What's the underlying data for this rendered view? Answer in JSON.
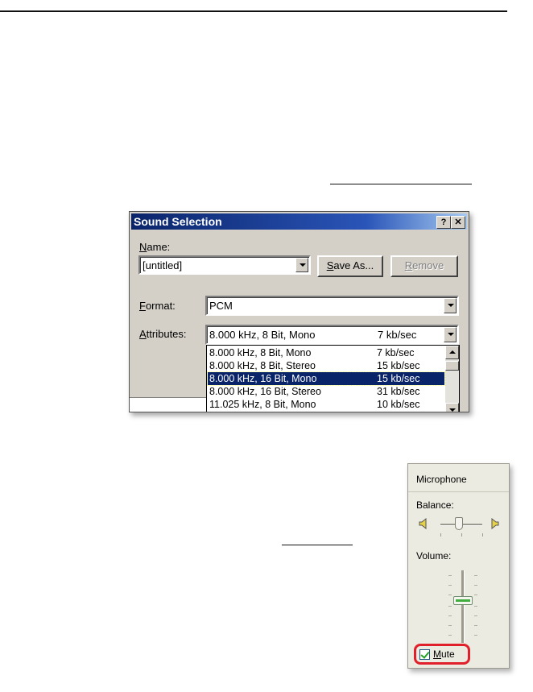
{
  "dialog": {
    "title": "Sound Selection",
    "help_label": "?",
    "close_label": "✕",
    "name_label_u": "N",
    "name_label_rest": "ame:",
    "name_value": "[untitled]",
    "save_as_u": "S",
    "save_as_rest": "ave As...",
    "remove_u": "R",
    "remove_rest": "emove",
    "format_label_u": "F",
    "format_label_rest": "ormat:",
    "format_value": "PCM",
    "attributes_label_u": "A",
    "attributes_label_rest": "ttributes:",
    "attributes_value": "8.000 kHz, 8 Bit, Mono",
    "attributes_rate": "7 kb/sec",
    "list": [
      {
        "spec": "8.000 kHz, 8 Bit, Mono",
        "rate": "7 kb/sec"
      },
      {
        "spec": "8.000 kHz, 8 Bit, Stereo",
        "rate": "15 kb/sec"
      },
      {
        "spec": "8.000 kHz, 16 Bit, Mono",
        "rate": "15 kb/sec"
      },
      {
        "spec": "8.000 kHz, 16 Bit, Stereo",
        "rate": "31 kb/sec"
      },
      {
        "spec": "11.025 kHz, 8 Bit, Mono",
        "rate": "10 kb/sec"
      }
    ],
    "selected_index": 2
  },
  "mixer": {
    "title": "Microphone",
    "balance_label": "Balance:",
    "volume_label": "Volume:",
    "mute_u": "M",
    "mute_rest": "ute",
    "mute_checked": true
  },
  "colors": {
    "title_bar": "#0a246a",
    "selection": "#0a246a",
    "mute_highlight": "#e0202a",
    "volume_thumb": "#3fae3f"
  }
}
